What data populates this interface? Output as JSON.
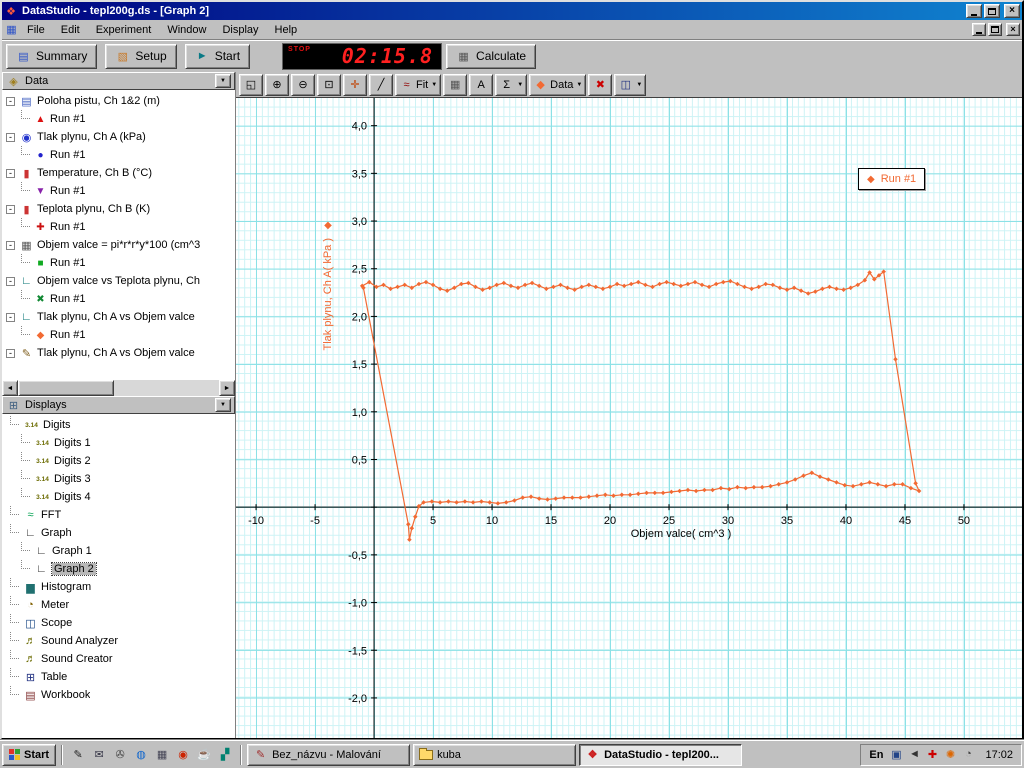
{
  "titlebar": {
    "title": "DataStudio - tepl200g.ds - [Graph 2]"
  },
  "menubar": {
    "items": [
      "File",
      "Edit",
      "Experiment",
      "Window",
      "Display",
      "Help"
    ]
  },
  "main_toolbar": {
    "summary": "Summary",
    "setup": "Setup",
    "start": "Start",
    "timer_mode": "STOP",
    "timer_value": "02:15.8",
    "calculate": "Calculate"
  },
  "graph_toolbar": {
    "buttons": [
      {
        "icon": "scale-to-fit-icon"
      },
      {
        "icon": "zoom-in-icon"
      },
      {
        "icon": "zoom-out-icon"
      },
      {
        "icon": "zoom-select-icon"
      },
      {
        "icon": "smart-tool-icon"
      },
      {
        "icon": "slope-tool-icon"
      },
      {
        "icon": "fit-icon",
        "label": "Fit",
        "dropdown": true
      },
      {
        "icon": "calculator-tool-icon"
      },
      {
        "icon": "text-tool-icon"
      },
      {
        "icon": "statistics-icon",
        "dropdown": true
      },
      {
        "icon": "data-menu-icon",
        "label": "Data",
        "dropdown": true
      },
      {
        "icon": "remove-data-icon"
      },
      {
        "icon": "graph-settings-icon",
        "dropdown": true
      }
    ]
  },
  "data_panel": {
    "title": "Data",
    "items": [
      {
        "icon": "position-sensor-icon",
        "label": "Poloha pistu, Ch 1&2 (m)",
        "runs": [
          {
            "label": "Run #1",
            "marker": "▲",
            "color": "#dd1111"
          }
        ]
      },
      {
        "icon": "pressure-sensor-icon",
        "label": "Tlak plynu, Ch A (kPa)",
        "runs": [
          {
            "label": "Run #1",
            "marker": "●",
            "color": "#2222cc"
          }
        ]
      },
      {
        "icon": "thermometer-icon",
        "label": "Temperature, Ch B (°C)",
        "runs": [
          {
            "label": "Run #1",
            "marker": "▼",
            "color": "#8822aa"
          }
        ]
      },
      {
        "icon": "thermometer-icon",
        "label": "Teplota plynu, Ch B (K)",
        "runs": [
          {
            "label": "Run #1",
            "marker": "✚",
            "color": "#cc1111"
          }
        ]
      },
      {
        "icon": "calculator-icon",
        "label": "Objem valce = pi*r*r*y*100 (cm^3",
        "runs": [
          {
            "label": "Run #1",
            "marker": "■",
            "color": "#11aa22"
          }
        ]
      },
      {
        "icon": "xy-data-icon",
        "label": "Objem valce vs Teplota plynu, Ch",
        "runs": [
          {
            "label": "Run #1",
            "marker": "✖",
            "color": "#118833"
          }
        ]
      },
      {
        "icon": "xy-data-icon",
        "label": "Tlak plynu, Ch A vs Objem valce",
        "runs": [
          {
            "label": "Run #1",
            "marker": "◆",
            "color": "#f26a33"
          }
        ]
      },
      {
        "icon": "pencil-icon",
        "label": "Tlak plynu, Ch A vs Objem valce",
        "runs": []
      }
    ]
  },
  "displays_panel": {
    "title": "Displays",
    "items": [
      {
        "icon": "digits-icon",
        "label": "Digits",
        "children": [
          {
            "icon": "digits-icon",
            "label": "Digits 1"
          },
          {
            "icon": "digits-icon",
            "label": "Digits 2"
          },
          {
            "icon": "digits-icon",
            "label": "Digits 3"
          },
          {
            "icon": "digits-icon",
            "label": "Digits 4"
          }
        ]
      },
      {
        "icon": "fft-icon",
        "label": "FFT",
        "children": []
      },
      {
        "icon": "graph-icon",
        "label": "Graph",
        "children": [
          {
            "icon": "graph-icon",
            "label": "Graph 1"
          },
          {
            "icon": "graph-icon",
            "label": "Graph 2",
            "selected": true
          }
        ]
      },
      {
        "icon": "histogram-icon",
        "label": "Histogram",
        "children": []
      },
      {
        "icon": "meter-icon",
        "label": "Meter",
        "children": []
      },
      {
        "icon": "scope-icon",
        "label": "Scope",
        "children": []
      },
      {
        "icon": "speaker-icon",
        "label": "Sound Analyzer",
        "children": []
      },
      {
        "icon": "speaker-icon",
        "label": "Sound Creator",
        "children": []
      },
      {
        "icon": "table-icon",
        "label": "Table",
        "children": []
      },
      {
        "icon": "workbook-icon",
        "label": "Workbook",
        "children": []
      }
    ]
  },
  "chart_data": {
    "type": "scatter",
    "title": "",
    "xlabel": "Objem valce( cm^3 )",
    "ylabel": "Tlak plynu, Ch A( kPa )",
    "xlim": [
      -11.7,
      54.92
    ],
    "ylim": [
      -2.42,
      4.29
    ],
    "x_ticks": [
      -10,
      -5,
      0,
      5,
      10,
      15,
      20,
      25,
      30,
      35,
      40,
      45,
      50
    ],
    "x_tick_labels": [
      "-10",
      "-5",
      "",
      "5",
      "10",
      "15",
      "20",
      "25",
      "30",
      "35",
      "40",
      "45",
      "50"
    ],
    "y_ticks": [
      -2.0,
      -1.5,
      -1.0,
      -0.5,
      0,
      0.5,
      1.0,
      1.5,
      2.0,
      2.5,
      3.0,
      3.5,
      4.0
    ],
    "y_tick_labels": [
      "-2,0",
      "-1,5",
      "-1,0",
      "-0,5",
      "",
      "0,5",
      "1,0",
      "1,5",
      "2,0",
      "2,5",
      "3,0",
      "3,5",
      "4,0"
    ],
    "grid": true,
    "legend_position": "top-right",
    "series": [
      {
        "name": "Run #1",
        "color": "#f26a33",
        "marker": "diamond",
        "points": [
          [
            -1.0,
            2.32
          ],
          [
            -0.4,
            2.36
          ],
          [
            0.2,
            2.31
          ],
          [
            0.8,
            2.33
          ],
          [
            1.4,
            2.29
          ],
          [
            2.0,
            2.31
          ],
          [
            2.6,
            2.33
          ],
          [
            3.2,
            2.3
          ],
          [
            3.8,
            2.34
          ],
          [
            4.4,
            2.36
          ],
          [
            5.0,
            2.33
          ],
          [
            5.6,
            2.29
          ],
          [
            6.2,
            2.27
          ],
          [
            6.8,
            2.3
          ],
          [
            7.4,
            2.34
          ],
          [
            8.0,
            2.35
          ],
          [
            8.6,
            2.31
          ],
          [
            9.2,
            2.28
          ],
          [
            9.8,
            2.3
          ],
          [
            10.4,
            2.33
          ],
          [
            11.0,
            2.35
          ],
          [
            11.6,
            2.32
          ],
          [
            12.2,
            2.3
          ],
          [
            12.8,
            2.33
          ],
          [
            13.4,
            2.35
          ],
          [
            14.0,
            2.32
          ],
          [
            14.6,
            2.29
          ],
          [
            15.2,
            2.31
          ],
          [
            15.8,
            2.33
          ],
          [
            16.4,
            2.3
          ],
          [
            17.0,
            2.28
          ],
          [
            17.6,
            2.31
          ],
          [
            18.2,
            2.33
          ],
          [
            18.8,
            2.31
          ],
          [
            19.4,
            2.29
          ],
          [
            20.0,
            2.31
          ],
          [
            20.6,
            2.34
          ],
          [
            21.2,
            2.32
          ],
          [
            21.8,
            2.34
          ],
          [
            22.4,
            2.36
          ],
          [
            23.0,
            2.33
          ],
          [
            23.6,
            2.31
          ],
          [
            24.2,
            2.34
          ],
          [
            24.8,
            2.36
          ],
          [
            25.4,
            2.34
          ],
          [
            26.0,
            2.32
          ],
          [
            26.6,
            2.34
          ],
          [
            27.2,
            2.36
          ],
          [
            27.8,
            2.33
          ],
          [
            28.4,
            2.31
          ],
          [
            29.0,
            2.34
          ],
          [
            29.6,
            2.36
          ],
          [
            30.2,
            2.37
          ],
          [
            30.8,
            2.34
          ],
          [
            31.4,
            2.31
          ],
          [
            32.0,
            2.29
          ],
          [
            32.6,
            2.31
          ],
          [
            33.2,
            2.34
          ],
          [
            33.8,
            2.33
          ],
          [
            34.4,
            2.3
          ],
          [
            35.0,
            2.28
          ],
          [
            35.6,
            2.3
          ],
          [
            36.2,
            2.27
          ],
          [
            36.8,
            2.24
          ],
          [
            37.4,
            2.26
          ],
          [
            38.0,
            2.29
          ],
          [
            38.6,
            2.31
          ],
          [
            39.2,
            2.29
          ],
          [
            39.8,
            2.28
          ],
          [
            40.4,
            2.3
          ],
          [
            41.0,
            2.33
          ],
          [
            41.6,
            2.38
          ],
          [
            42.0,
            2.46
          ],
          [
            42.4,
            2.39
          ],
          [
            42.8,
            2.43
          ],
          [
            43.2,
            2.47
          ],
          [
            44.2,
            1.55
          ],
          [
            45.9,
            0.25
          ],
          [
            46.2,
            0.17
          ],
          [
            45.5,
            0.2
          ],
          [
            44.8,
            0.24
          ],
          [
            44.1,
            0.24
          ],
          [
            43.4,
            0.22
          ],
          [
            42.7,
            0.24
          ],
          [
            42.0,
            0.26
          ],
          [
            41.3,
            0.24
          ],
          [
            40.6,
            0.22
          ],
          [
            39.9,
            0.23
          ],
          [
            39.2,
            0.26
          ],
          [
            38.5,
            0.29
          ],
          [
            37.8,
            0.32
          ],
          [
            37.1,
            0.36
          ],
          [
            36.4,
            0.33
          ],
          [
            35.7,
            0.29
          ],
          [
            35.0,
            0.26
          ],
          [
            34.3,
            0.24
          ],
          [
            33.6,
            0.22
          ],
          [
            32.9,
            0.21
          ],
          [
            32.2,
            0.21
          ],
          [
            31.5,
            0.2
          ],
          [
            30.8,
            0.21
          ],
          [
            30.1,
            0.19
          ],
          [
            29.4,
            0.2
          ],
          [
            28.7,
            0.18
          ],
          [
            28.0,
            0.18
          ],
          [
            27.3,
            0.17
          ],
          [
            26.6,
            0.18
          ],
          [
            25.9,
            0.17
          ],
          [
            25.2,
            0.16
          ],
          [
            24.5,
            0.15
          ],
          [
            23.8,
            0.15
          ],
          [
            23.1,
            0.15
          ],
          [
            22.4,
            0.14
          ],
          [
            21.7,
            0.13
          ],
          [
            21.0,
            0.13
          ],
          [
            20.3,
            0.12
          ],
          [
            19.6,
            0.13
          ],
          [
            18.9,
            0.12
          ],
          [
            18.2,
            0.11
          ],
          [
            17.5,
            0.1
          ],
          [
            16.8,
            0.1
          ],
          [
            16.1,
            0.1
          ],
          [
            15.4,
            0.09
          ],
          [
            14.7,
            0.08
          ],
          [
            14.0,
            0.09
          ],
          [
            13.3,
            0.11
          ],
          [
            12.6,
            0.1
          ],
          [
            11.9,
            0.07
          ],
          [
            11.2,
            0.05
          ],
          [
            10.5,
            0.04
          ],
          [
            9.8,
            0.05
          ],
          [
            9.1,
            0.06
          ],
          [
            8.4,
            0.05
          ],
          [
            7.7,
            0.06
          ],
          [
            7.0,
            0.05
          ],
          [
            6.3,
            0.06
          ],
          [
            5.6,
            0.05
          ],
          [
            4.9,
            0.06
          ],
          [
            4.2,
            0.05
          ],
          [
            3.8,
            0.01
          ],
          [
            3.5,
            -0.1
          ],
          [
            3.2,
            -0.22
          ],
          [
            3.0,
            -0.34
          ],
          [
            2.9,
            -0.18
          ],
          [
            -0.9,
            2.3
          ]
        ]
      }
    ]
  },
  "taskbar": {
    "start_label": "Start",
    "quick_launch": [
      "pencil-ql-icon",
      "mail-ql-icon",
      "media-ql-icon",
      "globe-ql-icon",
      "calc-ql-icon",
      "opera-ql-icon",
      "java-ql-icon",
      "chart-ql-icon"
    ],
    "tasks": [
      {
        "icon": "paint-icon",
        "label": "Bez_názvu - Malování",
        "active": false
      },
      {
        "icon": "folder-icon",
        "label": "kuba",
        "active": false
      },
      {
        "icon": "datastudio-icon",
        "label": "DataStudio - tepl200...",
        "active": true
      }
    ],
    "tray": {
      "lang": "En",
      "icons": [
        "display-tray-icon",
        "volume-tray-icon",
        "antivirus-tray-icon",
        "alert-tray-icon",
        "schedule-tray-icon"
      ],
      "time": "17:02"
    }
  }
}
